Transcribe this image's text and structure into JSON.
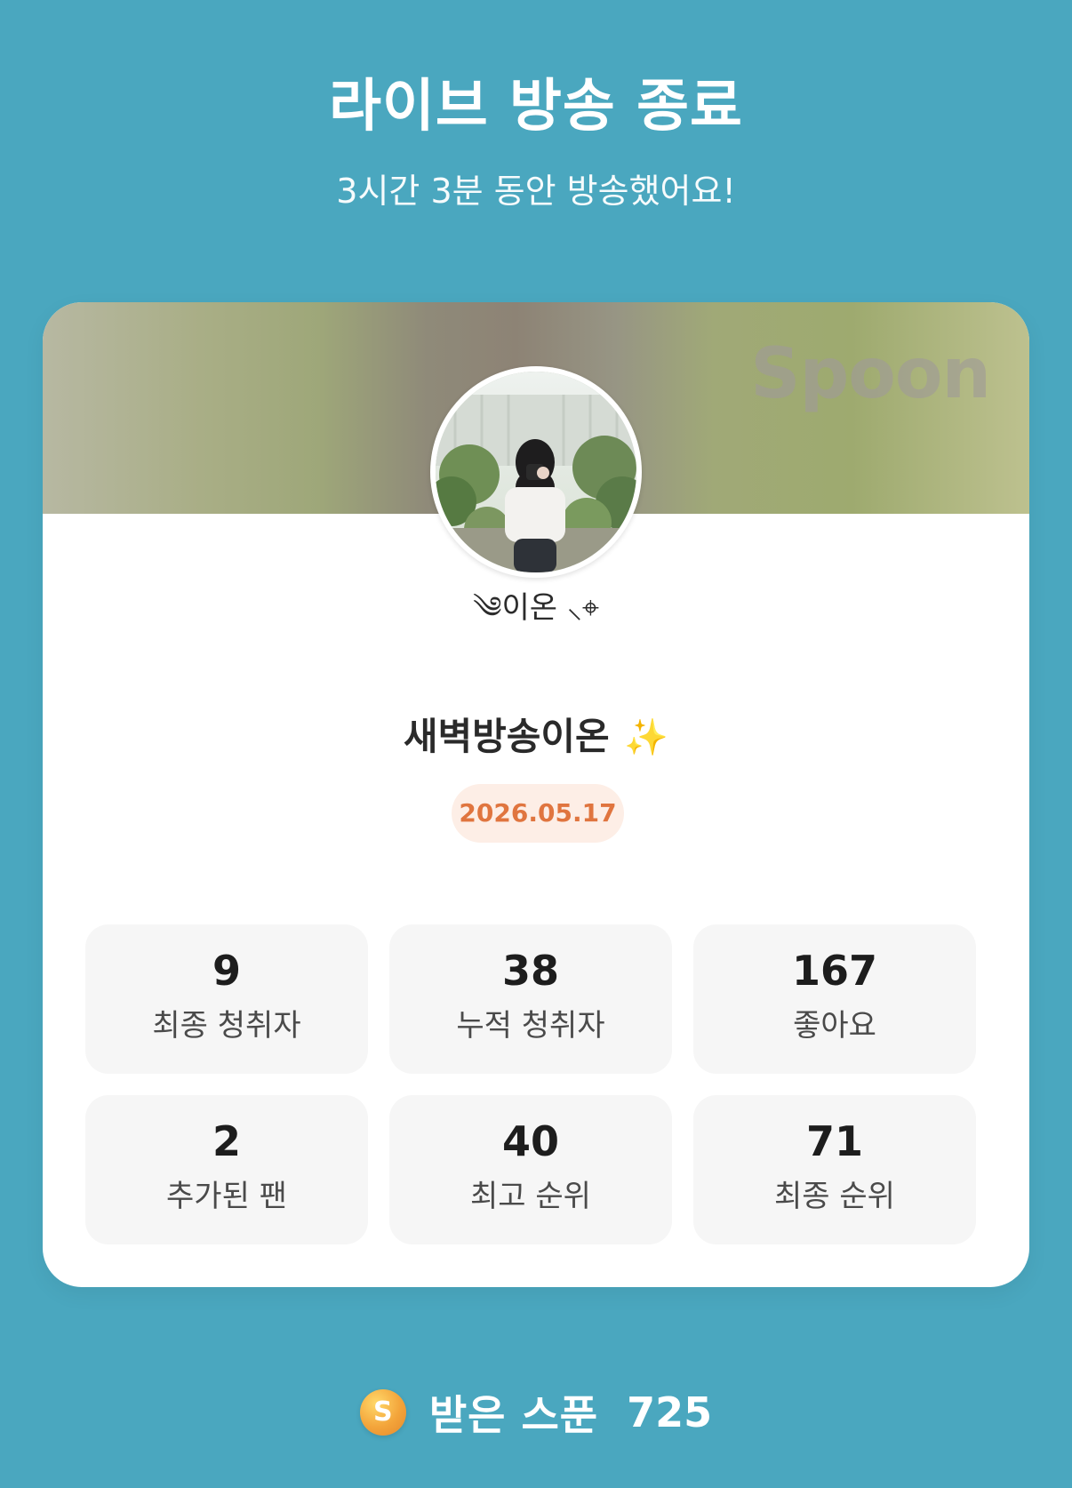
{
  "header": {
    "title": "라이브 방송 종료",
    "subtitle": "3시간 3분 동안 방송했어요!"
  },
  "card": {
    "watermark": "Spoon",
    "nickname": "༄이온 ⸜⌖",
    "broadcast_title": "새벽방송이온",
    "title_emoji": "✨",
    "date": "2026.05.17",
    "stats": [
      {
        "value": "9",
        "label": "최종 청취자"
      },
      {
        "value": "38",
        "label": "누적 청취자"
      },
      {
        "value": "167",
        "label": "좋아요"
      },
      {
        "value": "2",
        "label": "추가된 팬"
      },
      {
        "value": "40",
        "label": "최고 순위"
      },
      {
        "value": "71",
        "label": "최종 순위"
      }
    ]
  },
  "footer": {
    "coin_icon": "S",
    "label": "받은 스푼",
    "count": "725"
  },
  "colors": {
    "background": "#4aa7bf",
    "date_badge_bg": "#fdeee6",
    "date_badge_text": "#e0753f"
  }
}
